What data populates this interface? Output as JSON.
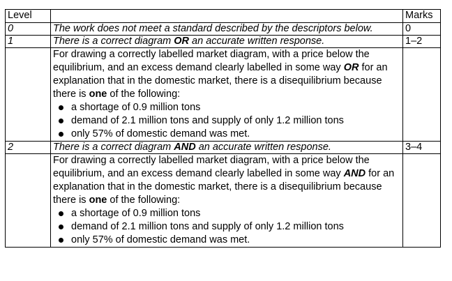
{
  "header": {
    "level": "Level",
    "description": "",
    "marks": "Marks"
  },
  "rows": [
    {
      "level": "0",
      "summary": "The work does not meet a standard described by the descriptors below.",
      "marks": "0"
    },
    {
      "level": "1",
      "summary_pre": "There is a correct diagram ",
      "summary_conj": "OR",
      "summary_post": " an accurate written response.",
      "marks": "1–2",
      "detail": {
        "t1": "For drawing a correctly labelled market diagram, with a price below the equilibrium, and an excess demand clearly labelled in some way ",
        "conj": "OR",
        "t2": " for an explanation that in the domestic market, there is a disequilibrium because there is ",
        "one": "one",
        "t3": " of the following:",
        "bullets": [
          "a shortage of 0.9 million tons",
          "demand of 2.1 million tons and supply of only 1.2 million tons",
          "only 57% of domestic demand was met."
        ]
      }
    },
    {
      "level": "2",
      "summary_pre": "There is a correct diagram ",
      "summary_conj": "AND",
      "summary_post": " an accurate written response.",
      "marks": "3–4",
      "detail": {
        "t1": "For drawing a correctly labelled market diagram, with a price below the equilibrium, and an excess demand clearly labelled in some way ",
        "conj": "AND",
        "t2": " for an explanation that in the domestic market, there is a disequilibrium because there is ",
        "one": "one",
        "t3": " of the following:",
        "bullets": [
          "a shortage of 0.9 million tons",
          "demand of 2.1 million tons and supply of only 1.2 million tons",
          "only 57% of domestic demand was met."
        ]
      }
    }
  ]
}
